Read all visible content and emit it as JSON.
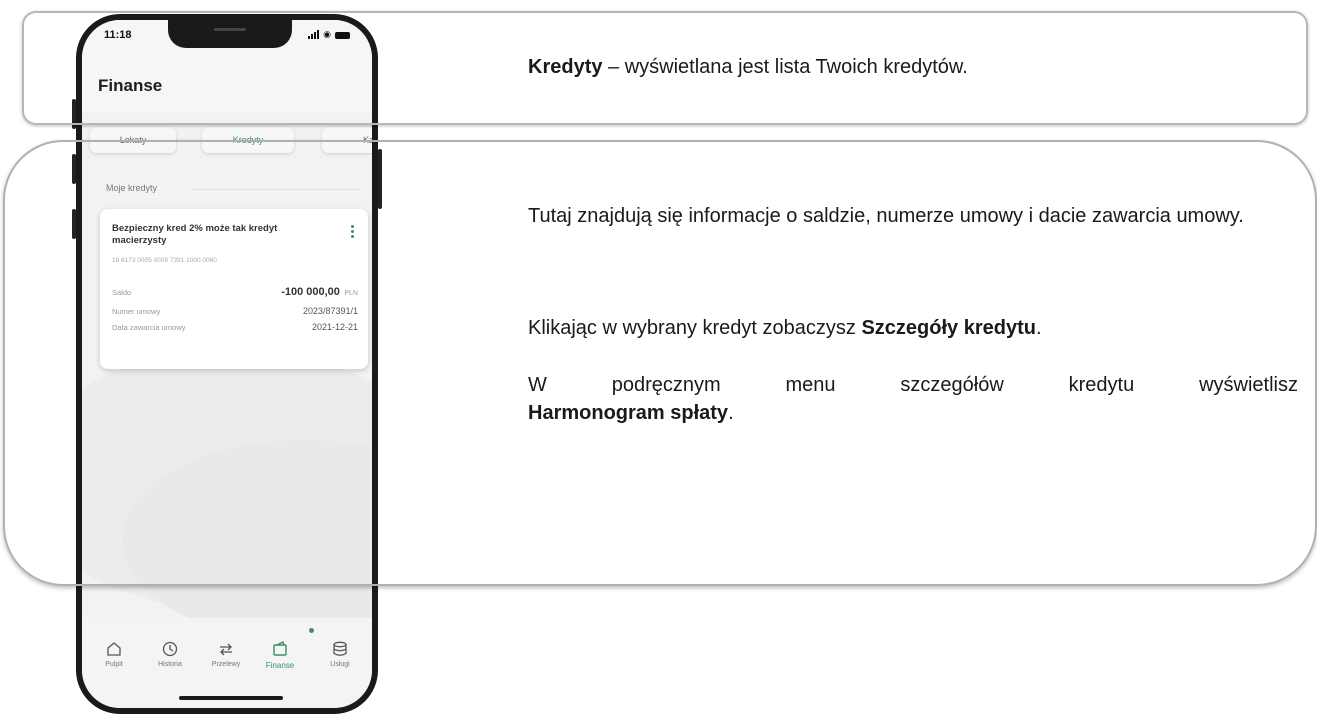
{
  "status": {
    "time": "11:18"
  },
  "app": {
    "title": "Finanse"
  },
  "tabs": [
    {
      "label": "Lokaty",
      "active": false
    },
    {
      "label": "Kredyty",
      "active": true
    },
    {
      "label": "Karty",
      "active": false
    }
  ],
  "section": {
    "label": "Moje kredyty"
  },
  "loan": {
    "name": "Bezpieczny kred 2% może tak kredyt macierzysty",
    "account": "18 8173 0005 0008 7391 1000 0060",
    "saldo_label": "Saldo",
    "saldo_amount": "-100 000,00",
    "saldo_currency": "PLN",
    "contract_label": "Numer umowy",
    "contract_value": "2023/87391/1",
    "date_label": "Data zawarcia umowy",
    "date_value": "2021-12-21"
  },
  "nav": [
    {
      "label": "Pulpit",
      "icon": "home-icon",
      "active": false
    },
    {
      "label": "Historia",
      "icon": "history-icon",
      "active": false
    },
    {
      "label": "Przelewy",
      "icon": "transfer-icon",
      "active": false
    },
    {
      "label": "Finanse",
      "icon": "finance-icon",
      "active": true
    },
    {
      "label": "Usługi",
      "icon": "services-icon",
      "active": false
    }
  ],
  "description": {
    "p1_bold": "Kredyty",
    "p1_rest": " – wyświetlana jest lista Twoich kredytów.",
    "p2": "Tutaj znajdują się informacje o saldzie, numerze umowy i dacie zawarcia umowy.",
    "p3_pre": "Klikając w wybrany kredyt  zobaczysz ",
    "p3_bold": "Szczegóły kredytu",
    "p3_post": ".",
    "p4_words": [
      "W",
      "podręcznym",
      "menu",
      "szczegółów",
      "kredytu",
      "wyświetlisz"
    ],
    "p4_bold": "Harmonogram spłaty",
    "p4_post": "."
  },
  "colors": {
    "accent": "#3f8f5f",
    "frame": "#b0b0b0"
  }
}
